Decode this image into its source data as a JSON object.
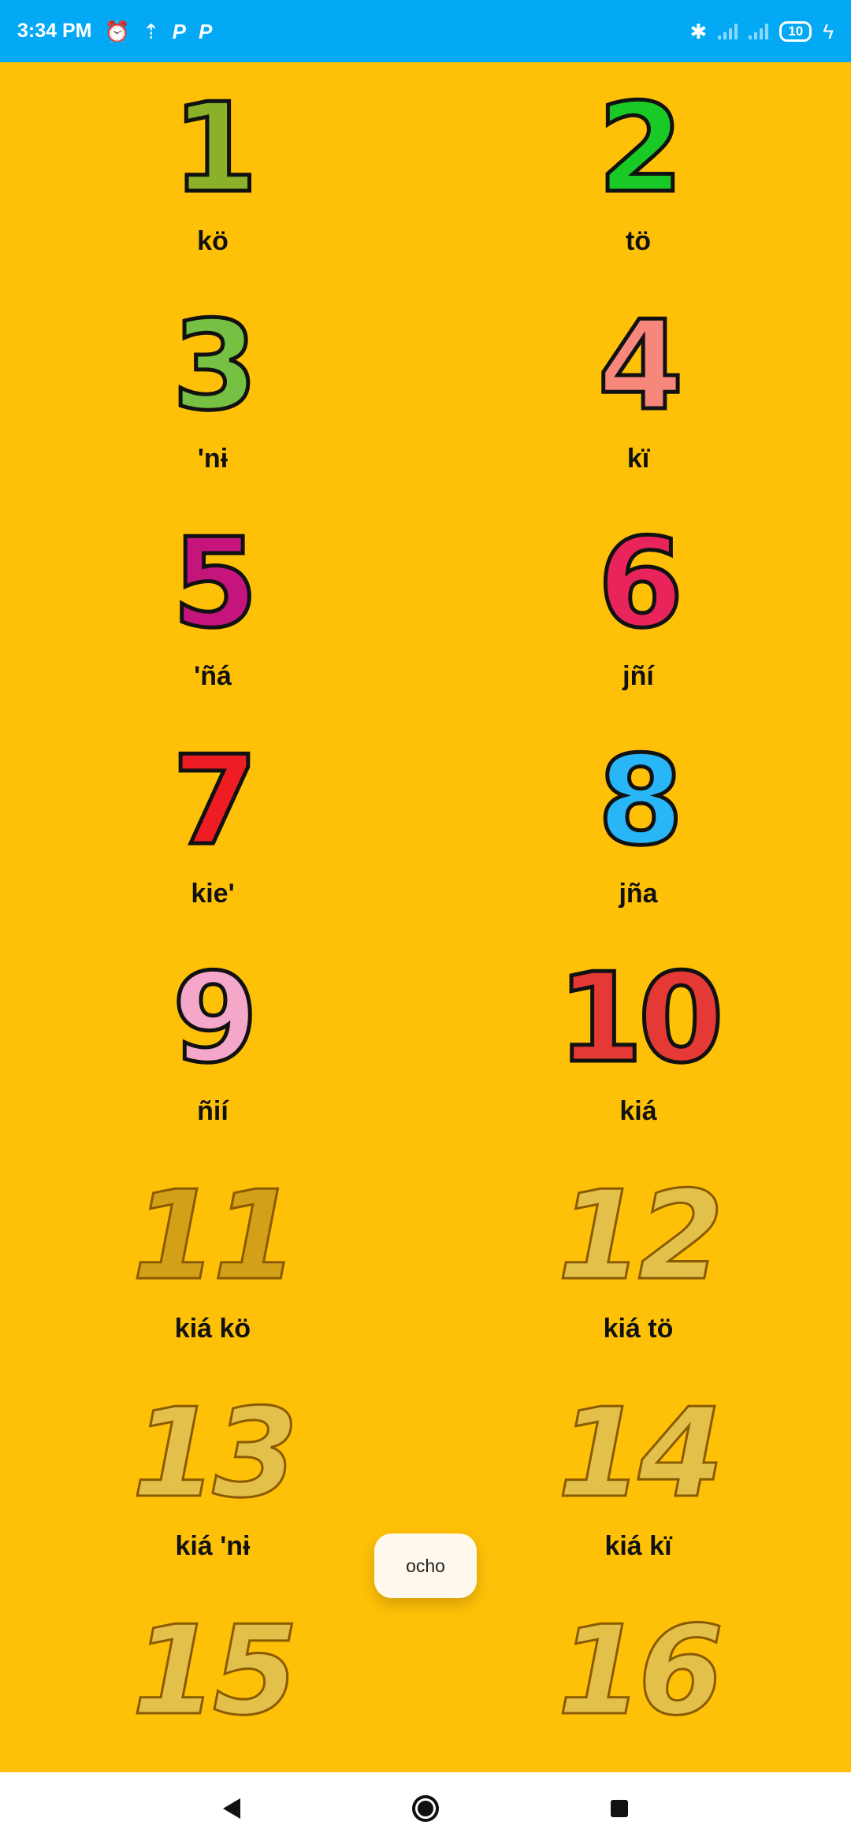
{
  "status_bar": {
    "time": "3:34 PM",
    "battery": "10",
    "icons": [
      "alarm-icon",
      "upload-icon",
      "p-app-icon",
      "p-app-icon",
      "bluetooth-icon",
      "signal-icon",
      "signal-icon",
      "charging-icon"
    ]
  },
  "numbers": [
    {
      "numeral": "1",
      "label": "kö",
      "color": "#8BB02A",
      "style": "cartoon"
    },
    {
      "numeral": "2",
      "label": "tö",
      "color": "#19C926",
      "style": "cartoon"
    },
    {
      "numeral": "3",
      "label": "'nɨ",
      "color": "#76C043",
      "style": "cartoon"
    },
    {
      "numeral": "4",
      "label": "kï",
      "color": "#F6877A",
      "style": "cartoon"
    },
    {
      "numeral": "5",
      "label": "'ñá",
      "color": "#C5157D",
      "style": "cartoon"
    },
    {
      "numeral": "6",
      "label": "jñí",
      "color": "#E8245A",
      "style": "cartoon"
    },
    {
      "numeral": "7",
      "label": "kie'",
      "color": "#EE1D23",
      "style": "cartoon"
    },
    {
      "numeral": "8",
      "label": "jña",
      "color": "#29B6F6",
      "style": "cartoon"
    },
    {
      "numeral": "9",
      "label": "ñií",
      "color": "#F4A7C8",
      "style": "cartoon"
    },
    {
      "numeral": "10",
      "label": "kiá",
      "color": "#E53935",
      "style": "cartoon"
    },
    {
      "numeral": "11",
      "label": "kiá kö",
      "color": "#D4A017",
      "style": "gold"
    },
    {
      "numeral": "12",
      "label": "kiá tö",
      "color": "#E3C04A",
      "style": "gold"
    },
    {
      "numeral": "13",
      "label": "kiá 'nɨ",
      "color": "#E3C04A",
      "style": "gold"
    },
    {
      "numeral": "14",
      "label": "kiá kï",
      "color": "#E3C04A",
      "style": "gold"
    },
    {
      "numeral": "15",
      "label": "",
      "color": "#E3C04A",
      "style": "gold"
    },
    {
      "numeral": "16",
      "label": "",
      "color": "#E3C04A",
      "style": "gold"
    }
  ],
  "toast": {
    "text": "ocho"
  },
  "nav_bar": {
    "icons": [
      "back-icon",
      "home-icon",
      "recents-icon"
    ]
  }
}
